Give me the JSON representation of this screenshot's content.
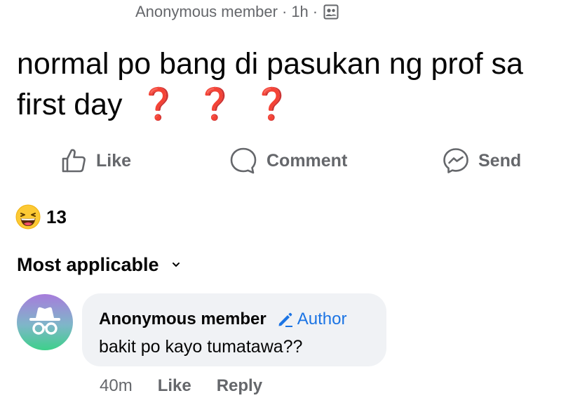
{
  "post": {
    "author": "Anonymous member",
    "time": "1h",
    "separator": "·",
    "audience_icon": "group-audience-icon",
    "text": "normal po bang di pasukan ng prof sa first day",
    "emoji": [
      "❓",
      "❓",
      "❓"
    ]
  },
  "actions": {
    "like": "Like",
    "comment": "Comment",
    "send": "Send"
  },
  "reactions": {
    "icon": "haha-reaction-icon",
    "count": "13"
  },
  "sort": {
    "label": "Most applicable"
  },
  "comment": {
    "author": "Anonymous member",
    "badge": "Author",
    "text": "bakit po kayo tumatawa??",
    "time": "40m",
    "like": "Like",
    "reply": "Reply"
  },
  "colors": {
    "secondary_text": "#65676b",
    "primary_text": "#050505",
    "author_badge": "#1b74e4",
    "question_mark": "#d32f2f",
    "bubble_bg": "#f0f2f5"
  }
}
